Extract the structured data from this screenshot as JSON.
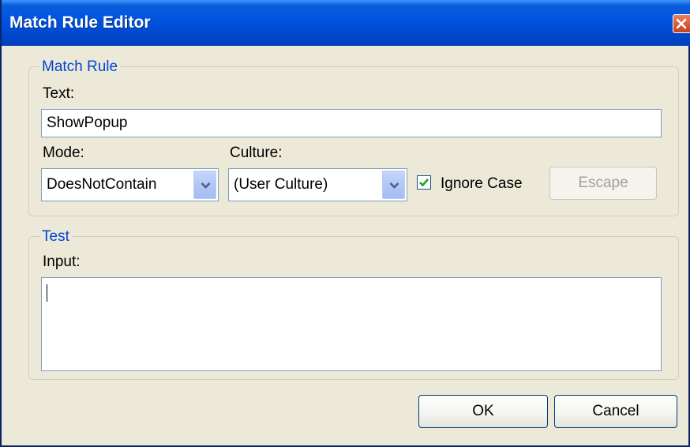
{
  "window": {
    "title": "Match Rule Editor"
  },
  "match_rule": {
    "legend": "Match Rule",
    "text_label": "Text:",
    "text_value": "ShowPopup",
    "mode_label": "Mode:",
    "mode_value": "DoesNotContain",
    "culture_label": "Culture:",
    "culture_value": "(User Culture)",
    "ignore_case_label": "Ignore Case",
    "ignore_case_checked": true,
    "escape_label": "Escape"
  },
  "test": {
    "legend": "Test",
    "input_label": "Input:",
    "input_value": ""
  },
  "buttons": {
    "ok": "OK",
    "cancel": "Cancel"
  },
  "colors": {
    "title_bar": "#0054e3",
    "legend_text": "#0046d5",
    "checkmark": "#21a121"
  }
}
